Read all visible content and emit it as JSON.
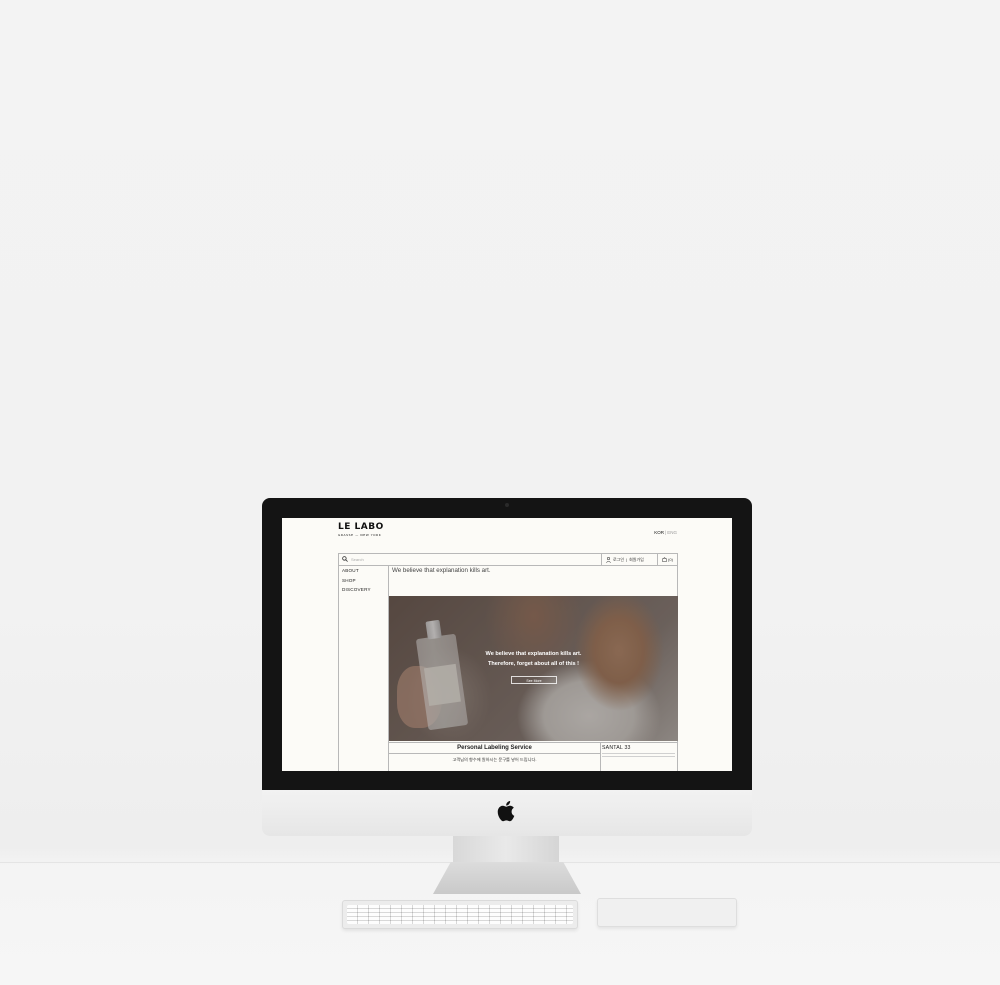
{
  "site": {
    "brand_name": "LE LABO",
    "brand_sub": "GRASSE — NEW YORK",
    "lang_active": "KOR",
    "lang_sep": "|",
    "lang_other": "ENG"
  },
  "search": {
    "placeholder": "Search"
  },
  "account": {
    "login": "로그인",
    "sep": "|",
    "join": "회원가입"
  },
  "cart": {
    "count": "(0)"
  },
  "nav": {
    "items": [
      "ABOUT",
      "SHOP",
      "DISCOVERY"
    ]
  },
  "main": {
    "tagline": "We believe that explanation kills art.",
    "hero_line1": "We believe that explanation kills art.",
    "hero_line2": "Therefore, forget about all of this !",
    "hero_button": "See More"
  },
  "labeling": {
    "title": "Personal Labeling Service",
    "korean": "고객님의 향수에 원하시는 문구를 넣어 드립니다."
  },
  "product": {
    "name": "SANTAL 33"
  }
}
